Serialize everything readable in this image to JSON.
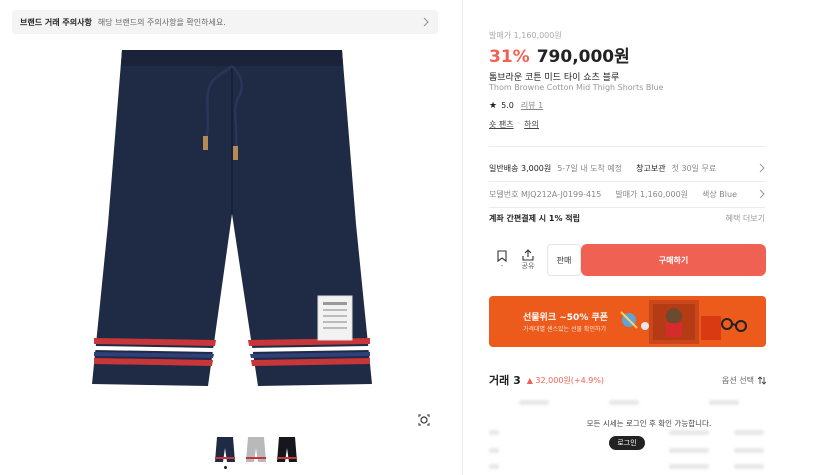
{
  "notice": {
    "title": "브랜드 거래 주의사항",
    "text": "해당 브랜드의 주의사항을 확인하세요."
  },
  "product": {
    "original_price": "발매가 1,160,000원",
    "discount": "31%",
    "price": "790,000원",
    "name_ko": "톰브라운 코튼 미드 타이 쇼츠 블루",
    "name_en": "Thom Browne Cotton Mid Thigh Shorts Blue",
    "rating": "5.0",
    "review_label": "리뷰 1",
    "category_1": "숏 팬츠",
    "category_sep": "·",
    "category_2": "하의"
  },
  "shipping": {
    "label": "일반배송 3,000원",
    "eta": "5-7일 내 도착 예정",
    "storage_label": "창고보관",
    "storage_val": "첫 30일 무료"
  },
  "specs": {
    "model": "모델번호 MJQ212A-J0199-415",
    "release": "발매가 1,160,000원",
    "color": "색상 Blue"
  },
  "payment": {
    "label": "계좌 간편결제 시 1% 적립",
    "more": "혜택 더보기"
  },
  "actions": {
    "bookmark_count": "-",
    "share_label": "공유",
    "sell_label": "판매",
    "buy_label": "구매하기"
  },
  "banner": {
    "title": "선물위크 ~50% 쿠폰",
    "subtitle": "가격대별 센스있는 선물 확인하기"
  },
  "trade": {
    "title": "거래 3",
    "change": "▲ 32,000원(+4.9%)",
    "option_label": "옵션 선택",
    "login_message": "모든 시세는 로그인 후 확인 가능합니다.",
    "login_button": "로그인"
  },
  "colors": {
    "accent": "#ef6253",
    "banner": "#ec5a1c",
    "navy": "#1f2a44"
  }
}
